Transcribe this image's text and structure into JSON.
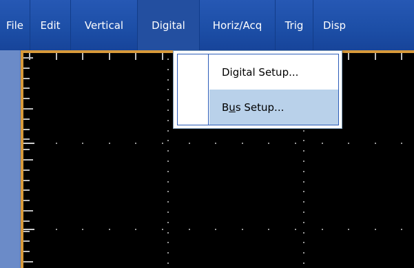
{
  "menu": {
    "items": [
      {
        "label": "File"
      },
      {
        "label": "Edit"
      },
      {
        "label": "Vertical"
      },
      {
        "label": "Digital"
      },
      {
        "label": "Horiz/Acq"
      },
      {
        "label": "Trig"
      },
      {
        "label": "Disp"
      }
    ]
  },
  "dropdown": {
    "items": [
      {
        "label_pre": "Di",
        "label_mn": "g",
        "label_post": "ital Setup..."
      },
      {
        "label_pre": "B",
        "label_mn": "u",
        "label_post": "s Setup..."
      }
    ]
  },
  "colors": {
    "menubar": "#1c4ea6",
    "display_border": "#d89a3a",
    "screen": "#000000",
    "highlight": "#b9d1ea"
  }
}
